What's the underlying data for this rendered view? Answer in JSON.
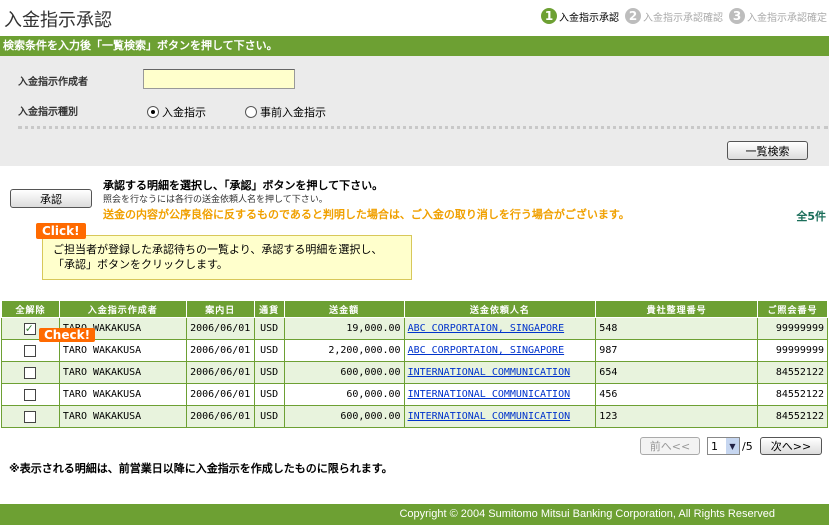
{
  "header": {
    "title": "入金指示承認",
    "steps": [
      {
        "num": "1",
        "label": "入金指示承認"
      },
      {
        "num": "2",
        "label": "入金指示承認確認"
      },
      {
        "num": "3",
        "label": "入金指示承認確定"
      }
    ]
  },
  "search": {
    "bar_text": "検索条件を入力後「一覧検索」ボタンを押して下さい。",
    "creator_label": "入金指示作成者",
    "creator_value": "",
    "type_label": "入金指示種別",
    "type_options": [
      "入金指示",
      "事前入金指示"
    ],
    "selected_type": "入金指示",
    "search_button": "一覧検索"
  },
  "approval": {
    "approve_button": "承認",
    "instruction": "承認する明細を選択し、「承認」ボタンを押して下さい。",
    "sub_instruction": "照会を行なうには各行の送金依頼人名を押して下さい。",
    "warning": "送金の内容が公序良俗に反するものであると判明した場合は、ご入金の取り消しを行う場合がございます。",
    "total": "全5件",
    "click_tag": "Click!",
    "callout_line1": "ご担当者が登録した承認待ちの一覧より、承認する明細を選択し、",
    "callout_line2": "「承認」ボタンをクリックします。",
    "check_tag": "Check!"
  },
  "table": {
    "headers": [
      "全解除",
      "入金指示作成者",
      "案内日",
      "通貨",
      "送金額",
      "送金依頼人名",
      "貴社整理番号",
      "ご照会番号"
    ],
    "rows": [
      {
        "checked": true,
        "creator": "TARO WAKAKUSA",
        "date": "2006/06/01",
        "currency": "USD",
        "amount": "19,000.00",
        "remitter": "ABC CORPORTAION, SINGAPORE",
        "ref": "548",
        "inquiry": "99999999"
      },
      {
        "checked": false,
        "creator": "TARO WAKAKUSA",
        "date": "2006/06/01",
        "currency": "USD",
        "amount": "2,200,000.00",
        "remitter": "ABC CORPORTAION, SINGAPORE",
        "ref": "987",
        "inquiry": "99999999"
      },
      {
        "checked": false,
        "creator": "TARO WAKAKUSA",
        "date": "2006/06/01",
        "currency": "USD",
        "amount": "600,000.00",
        "remitter": "INTERNATIONAL COMMUNICATION",
        "ref": "654",
        "inquiry": "84552122"
      },
      {
        "checked": false,
        "creator": "TARO WAKAKUSA",
        "date": "2006/06/01",
        "currency": "USD",
        "amount": "60,000.00",
        "remitter": "INTERNATIONAL COMMUNICATION",
        "ref": "456",
        "inquiry": "84552122"
      },
      {
        "checked": false,
        "creator": "TARO WAKAKUSA",
        "date": "2006/06/01",
        "currency": "USD",
        "amount": "600,000.00",
        "remitter": "INTERNATIONAL COMMUNICATION",
        "ref": "123",
        "inquiry": "84552122"
      }
    ]
  },
  "pager": {
    "prev_label": "前へ<<",
    "current_page": "1",
    "total_pages": "/5",
    "next_label": "次へ>>"
  },
  "note": "※表示される明細は、前営業日以降に入金指示を作成したものに限られます。",
  "footer": {
    "copyright": "Copyright © 2004 Sumitomo Mitsui Banking Corporation, All Rights Reserved"
  },
  "colors": {
    "brand_green": "#6da033",
    "accent_orange": "#ff6a00",
    "warning_text": "#f0a000"
  }
}
